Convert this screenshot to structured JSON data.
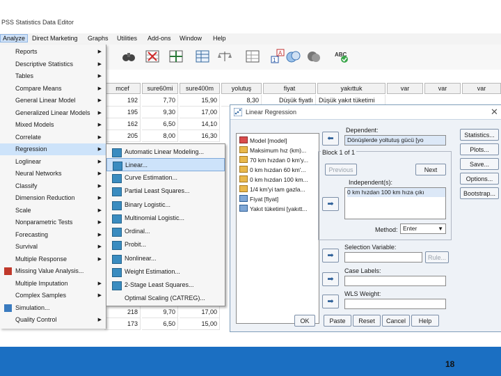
{
  "window": {
    "title": "PSS Statistics Data Editor"
  },
  "menubar": {
    "items": [
      {
        "label": "Analyze",
        "active": true
      },
      {
        "label": "Direct Marketing"
      },
      {
        "label": "Graphs"
      },
      {
        "label": "Utilities"
      },
      {
        "label": "Add-ons"
      },
      {
        "label": "Window"
      },
      {
        "label": "Help"
      }
    ]
  },
  "analyze_menu": {
    "items": [
      "Reports",
      "Descriptive Statistics",
      "Tables",
      "Compare Means",
      "General Linear Model",
      "Generalized Linear Models",
      "Mixed Models",
      "Correlate",
      "Regression",
      "Loglinear",
      "Neural Networks",
      "Classify",
      "Dimension Reduction",
      "Scale",
      "Nonparametric Tests",
      "Forecasting",
      "Survival",
      "Multiple Response",
      "Missing Value Analysis...",
      "Multiple Imputation",
      "Complex Samples",
      "Simulation...",
      "Quality Control"
    ],
    "selected": "Regression"
  },
  "regression_submenu": {
    "items": [
      "Automatic Linear Modeling...",
      "Linear...",
      "Curve Estimation...",
      "Partial Least Squares...",
      "Binary Logistic...",
      "Multinomial Logistic...",
      "Ordinal...",
      "Probit...",
      "Nonlinear...",
      "Weight Estimation...",
      "2-Stage Least Squares...",
      "Optimal Scaling (CATREG)..."
    ],
    "selected": "Linear..."
  },
  "data_grid": {
    "headers": [
      "mcef",
      "sure60mi",
      "sure400m",
      "yolutuş",
      "fiyat",
      "yakıttuk",
      "var",
      "var",
      "var"
    ],
    "rows": [
      [
        "192",
        "7,70",
        "15,90",
        "8,30",
        "Düşük fiyatlı",
        "Düşük yakıt tüketimi"
      ],
      [
        "195",
        "9,30",
        "17,00",
        "",
        "",
        ""
      ],
      [
        "162",
        "6,50",
        "14,10",
        "",
        "",
        ""
      ],
      [
        "205",
        "8,00",
        "16,30",
        "",
        "",
        ""
      ],
      [
        "218",
        "9,70",
        "17,00",
        "",
        "",
        ""
      ],
      [
        "173",
        "6,50",
        "15,00",
        "",
        "",
        ""
      ]
    ]
  },
  "dialog": {
    "title": "Linear Regression",
    "variables": [
      "Model [model]",
      "Maksimum hız (km)...",
      "70 km hızdan 0 km'y...",
      "0 km hızdan 60 km'...",
      "0 km hızdan 100 km...",
      "1/4 km'yi tam gazla...",
      "Fiyat [fiyat]",
      "Yakıt tüketimi [yakıtt..."
    ],
    "dependent_label": "Dependent:",
    "dependent_value": "Dönüşlerde yoltutuş gücü [yo",
    "block_label": "Block 1 of 1",
    "previous": "Previous",
    "next": "Next",
    "independents_label": "Independent(s):",
    "independents_value": "0 km hızdan 100 km hıza çıkı",
    "method_label": "Method:",
    "method_value": "Enter",
    "selection_label": "Selection Variable:",
    "rule": "Rule...",
    "case_labels": "Case Labels:",
    "wls_weight": "WLS Weight:",
    "side_buttons": [
      "Statistics...",
      "Plots...",
      "Save...",
      "Options...",
      "Bootstrap..."
    ],
    "bottom_buttons": [
      "OK",
      "Paste",
      "Reset",
      "Cancel",
      "Help"
    ]
  },
  "footer": {
    "page_number": "18"
  }
}
